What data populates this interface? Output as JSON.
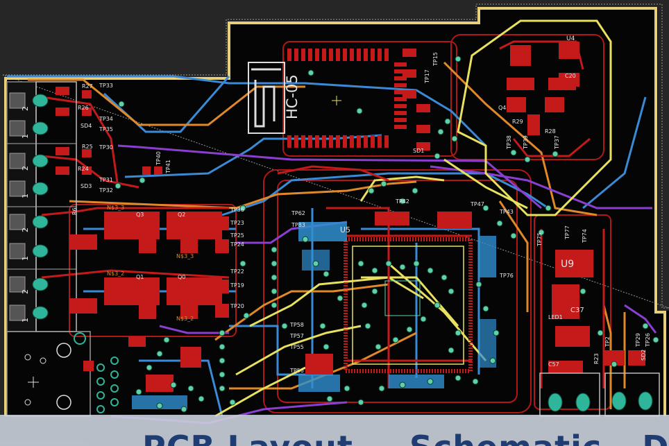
{
  "colors": {
    "background": "#262626",
    "board_bg": "#050505",
    "outline": "#e8cf7a",
    "top_copper": "#c41a1a",
    "bottom_copper": "#2f8fd0",
    "via": "#5fd1a6",
    "orange_trace": "#e0892a",
    "blue_trace": "#3a8ad6",
    "purple_trace": "#8a3fd1",
    "yellow_trace": "#e8e060",
    "silkscreen": "#e6e6e6",
    "overlay_text": "#1f3d73"
  },
  "module": {
    "name": "HC-05"
  },
  "labels": {
    "tp": [
      "TP33",
      "TP34",
      "TP35",
      "TP30",
      "TP31",
      "TP32",
      "TP36",
      "TP23",
      "TP24",
      "TP25",
      "TP19",
      "TP20",
      "TP22",
      "TP62",
      "TP83",
      "TP57",
      "TP55",
      "TP58",
      "TP56",
      "TP42",
      "TP43",
      "TP47",
      "TP38",
      "TP39",
      "TP37",
      "TP77",
      "TP76",
      "TP74",
      "TP75",
      "TP26",
      "TP2",
      "TP29",
      "TP15",
      "TP17",
      "TP40",
      "TP41"
    ],
    "r": [
      "R27",
      "R25",
      "R26",
      "R24",
      "R29",
      "R28",
      "R23",
      "R6"
    ],
    "q": [
      "Q3",
      "Q2",
      "Q1",
      "Q0",
      "Q4"
    ],
    "sd": [
      "SD4",
      "SD3",
      "SD1",
      "SD2"
    ],
    "u": [
      "U4",
      "U9",
      "U5"
    ],
    "c": [
      "C20",
      "C37",
      "C57"
    ],
    "led": [
      "LED1"
    ],
    "net": [
      "N$3_3",
      "N$3_2"
    ],
    "con": [
      "2",
      "1",
      "2",
      "1",
      "2",
      "1",
      "2",
      "1"
    ]
  },
  "overlay": {
    "title": "PCB Layout — Schematic – Del"
  }
}
